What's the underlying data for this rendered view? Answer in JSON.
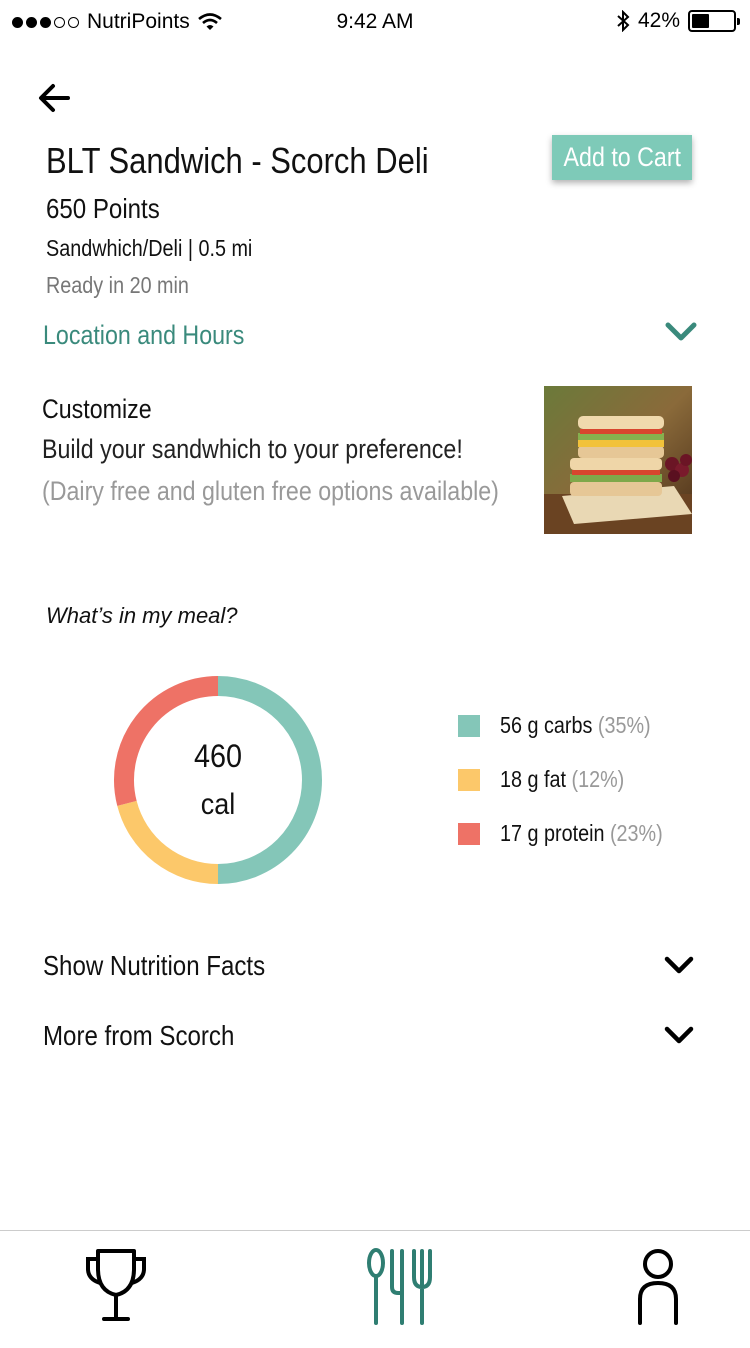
{
  "status_bar": {
    "carrier": "NutriPoints",
    "time": "9:42 AM",
    "battery": "42%",
    "battery_level": 0.42
  },
  "item": {
    "title": "BLT Sandwich - Scorch Deli",
    "add_to_cart": "Add to Cart",
    "points": "650 Points",
    "category": "Sandwhich/Deli | 0.5 mi",
    "ready": "Ready in 20 min"
  },
  "location": {
    "label": "Location and Hours"
  },
  "customize": {
    "title": "Customize",
    "description": "Build your sandwhich to your preference!",
    "note": "(Dairy free and gluten free options available)"
  },
  "meal": {
    "question": "What’s in my meal?",
    "calories": "460",
    "calories_unit": "cal"
  },
  "chart_data": {
    "type": "pie",
    "center_value": "460",
    "center_label": "cal",
    "slices": [
      {
        "label": "56 g carbs",
        "percent": "(35%)",
        "share": 0.5,
        "color": "#84c6b8"
      },
      {
        "label": "18 g fat",
        "percent": "(12%)",
        "share": 0.21,
        "color": "#fcc86a"
      },
      {
        "label": "17 g protein",
        "percent": "(23%)",
        "share": 0.29,
        "color": "#ee7266"
      }
    ]
  },
  "sections": {
    "nutrition": "Show Nutrition Facts",
    "more": "More from Scorch"
  },
  "tabs": [
    {
      "icon": "trophy-icon"
    },
    {
      "icon": "utensils-icon",
      "active": true
    },
    {
      "icon": "person-icon"
    }
  ],
  "colors": {
    "accent": "#7ecab8",
    "link": "#3a8a7c",
    "carbs": "#84c6b8",
    "fat": "#fcc86a",
    "protein": "#ee7266"
  }
}
